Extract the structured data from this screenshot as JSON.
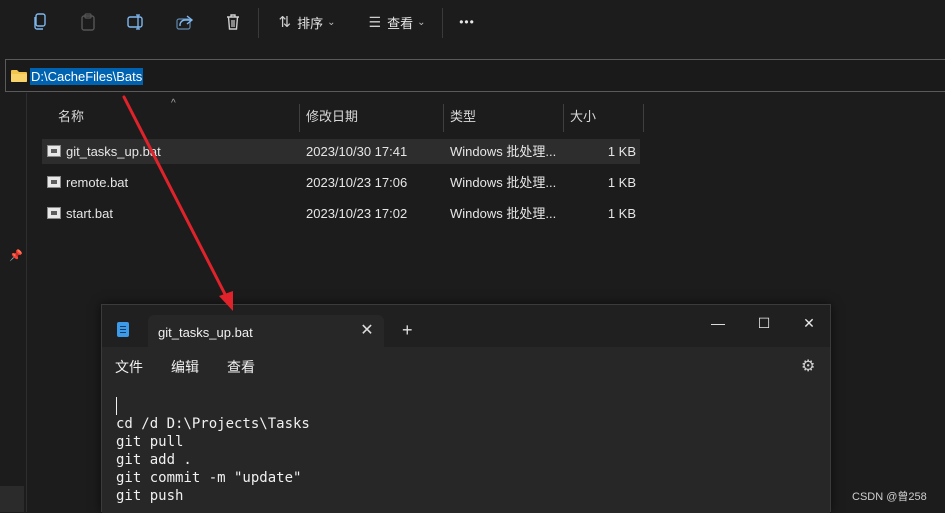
{
  "toolbar": {
    "icons": [
      "copy-icon",
      "paste-icon",
      "rename-icon",
      "share-icon",
      "delete-icon"
    ],
    "sort_label": "排序",
    "view_label": "查看",
    "more_label": "•••"
  },
  "address_bar": {
    "path": "D:\\CacheFiles\\Bats"
  },
  "file_list": {
    "columns": [
      "名称",
      "修改日期",
      "类型",
      "大小"
    ],
    "rows": [
      {
        "name": "git_tasks_up.bat",
        "modified": "2023/10/30 17:41",
        "type": "Windows 批处理...",
        "size": "1 KB"
      },
      {
        "name": "remote.bat",
        "modified": "2023/10/23 17:06",
        "type": "Windows 批处理...",
        "size": "1 KB"
      },
      {
        "name": "start.bat",
        "modified": "2023/10/23 17:02",
        "type": "Windows 批处理...",
        "size": "1 KB"
      }
    ]
  },
  "notepad": {
    "tab_title": "git_tasks_up.bat",
    "tab_close": "✕",
    "new_tab": "+",
    "window_controls": {
      "minimize": "—",
      "maximize": "☐",
      "close": "✕"
    },
    "menu": [
      "文件",
      "编辑",
      "查看"
    ],
    "content_lines": [
      "cd /d D:\\Projects\\Tasks",
      "git pull",
      "git add .",
      "git commit -m \"update\"",
      "git push"
    ]
  },
  "watermark": "CSDN @曾258",
  "colors": {
    "background": "#1c1c1c",
    "selection": "#0063b1",
    "accent": "#3d9be9",
    "annotation_arrow": "#e0232b"
  }
}
